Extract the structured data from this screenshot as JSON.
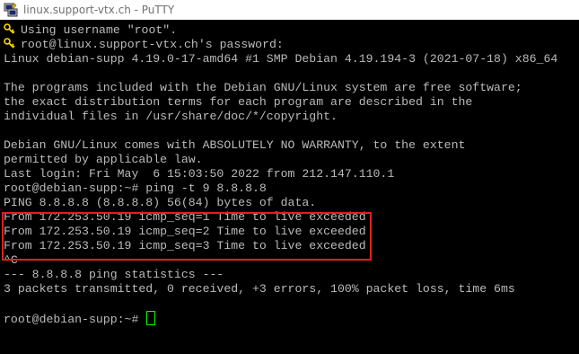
{
  "window": {
    "title": "linux.support-vtx.ch - PuTTY"
  },
  "terminal": {
    "lines": [
      "Using username \"root\".",
      "root@linux.support-vtx.ch's password:",
      "Linux debian-supp 4.19.0-17-amd64 #1 SMP Debian 4.19.194-3 (2021-07-18) x86_64",
      "",
      "The programs included with the Debian GNU/Linux system are free software;",
      "the exact distribution terms for each program are described in the",
      "individual files in /usr/share/doc/*/copyright.",
      "",
      "Debian GNU/Linux comes with ABSOLUTELY NO WARRANTY, to the extent",
      "permitted by applicable law.",
      "Last login: Fri May  6 15:03:50 2022 from 212.147.110.1",
      "root@debian-supp:~# ping -t 9 8.8.8.8",
      "PING 8.8.8.8 (8.8.8.8) 56(84) bytes of data.",
      "From 172.253.50.19 icmp_seq=1 Time to live exceeded",
      "From 172.253.50.19 icmp_seq=2 Time to live exceeded",
      "From 172.253.50.19 icmp_seq=3 Time to live exceeded",
      "^C",
      "--- 8.8.8.8 ping statistics ---",
      "3 packets transmitted, 0 received, +3 errors, 100% packet loss, time 6ms",
      "",
      "root@debian-supp:~# "
    ],
    "foreground_color": "#bbbbbb",
    "background_color": "#000000",
    "cursor_color": "#00ff00",
    "highlight_color": "#e02020"
  }
}
